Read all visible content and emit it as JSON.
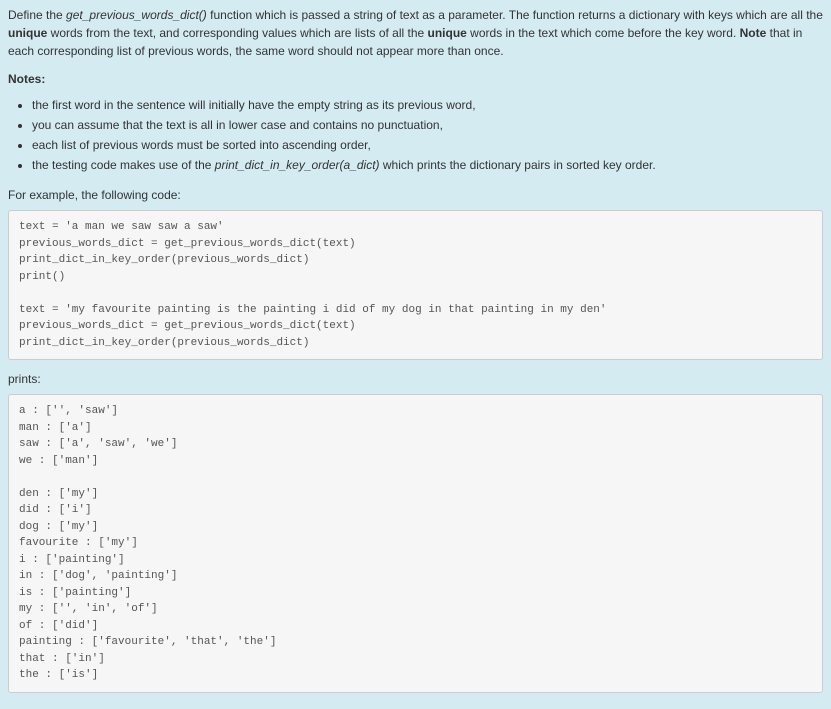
{
  "intro": {
    "prefix": "Define the ",
    "fn_name": "get_previous_words_dict()",
    "mid1": " function which is passed a string of text as a parameter.  The function returns a dictionary with keys which are all the ",
    "bold1": "unique",
    "mid2": " words from the text, and corresponding values which are lists of all the ",
    "bold2": "unique",
    "mid3": " words in the text which come before the key word.  ",
    "bold3": "Note",
    "mid4": " that in each corresponding list of previous words, the same word should not appear more than once."
  },
  "notes_heading": "Notes",
  "notes": [
    "the first word in the sentence will initially have the empty string as its previous word,",
    "you can assume that the text is all in lower case and contains no punctuation,",
    "each list of previous words must be sorted into ascending order,"
  ],
  "note4": {
    "prefix": "the testing code makes use of the ",
    "fn": "print_dict_in_key_order(a_dict)",
    "suffix": " which prints the dictionary pairs in sorted key order."
  },
  "example_label": "For example, the following code:",
  "code1": "text = 'a man we saw saw a saw'\nprevious_words_dict = get_previous_words_dict(text)\nprint_dict_in_key_order(previous_words_dict)\nprint()\n\ntext = 'my favourite painting is the painting i did of my dog in that painting in my den'\nprevious_words_dict = get_previous_words_dict(text)\nprint_dict_in_key_order(previous_words_dict)",
  "prints_label": "prints:",
  "code2": "a : ['', 'saw']\nman : ['a']\nsaw : ['a', 'saw', 'we']\nwe : ['man']\n\nden : ['my']\ndid : ['i']\ndog : ['my']\nfavourite : ['my']\ni : ['painting']\nin : ['dog', 'painting']\nis : ['painting']\nmy : ['', 'in', 'of']\nof : ['did']\npainting : ['favourite', 'that', 'the']\nthat : ['in']\nthe : ['is']"
}
